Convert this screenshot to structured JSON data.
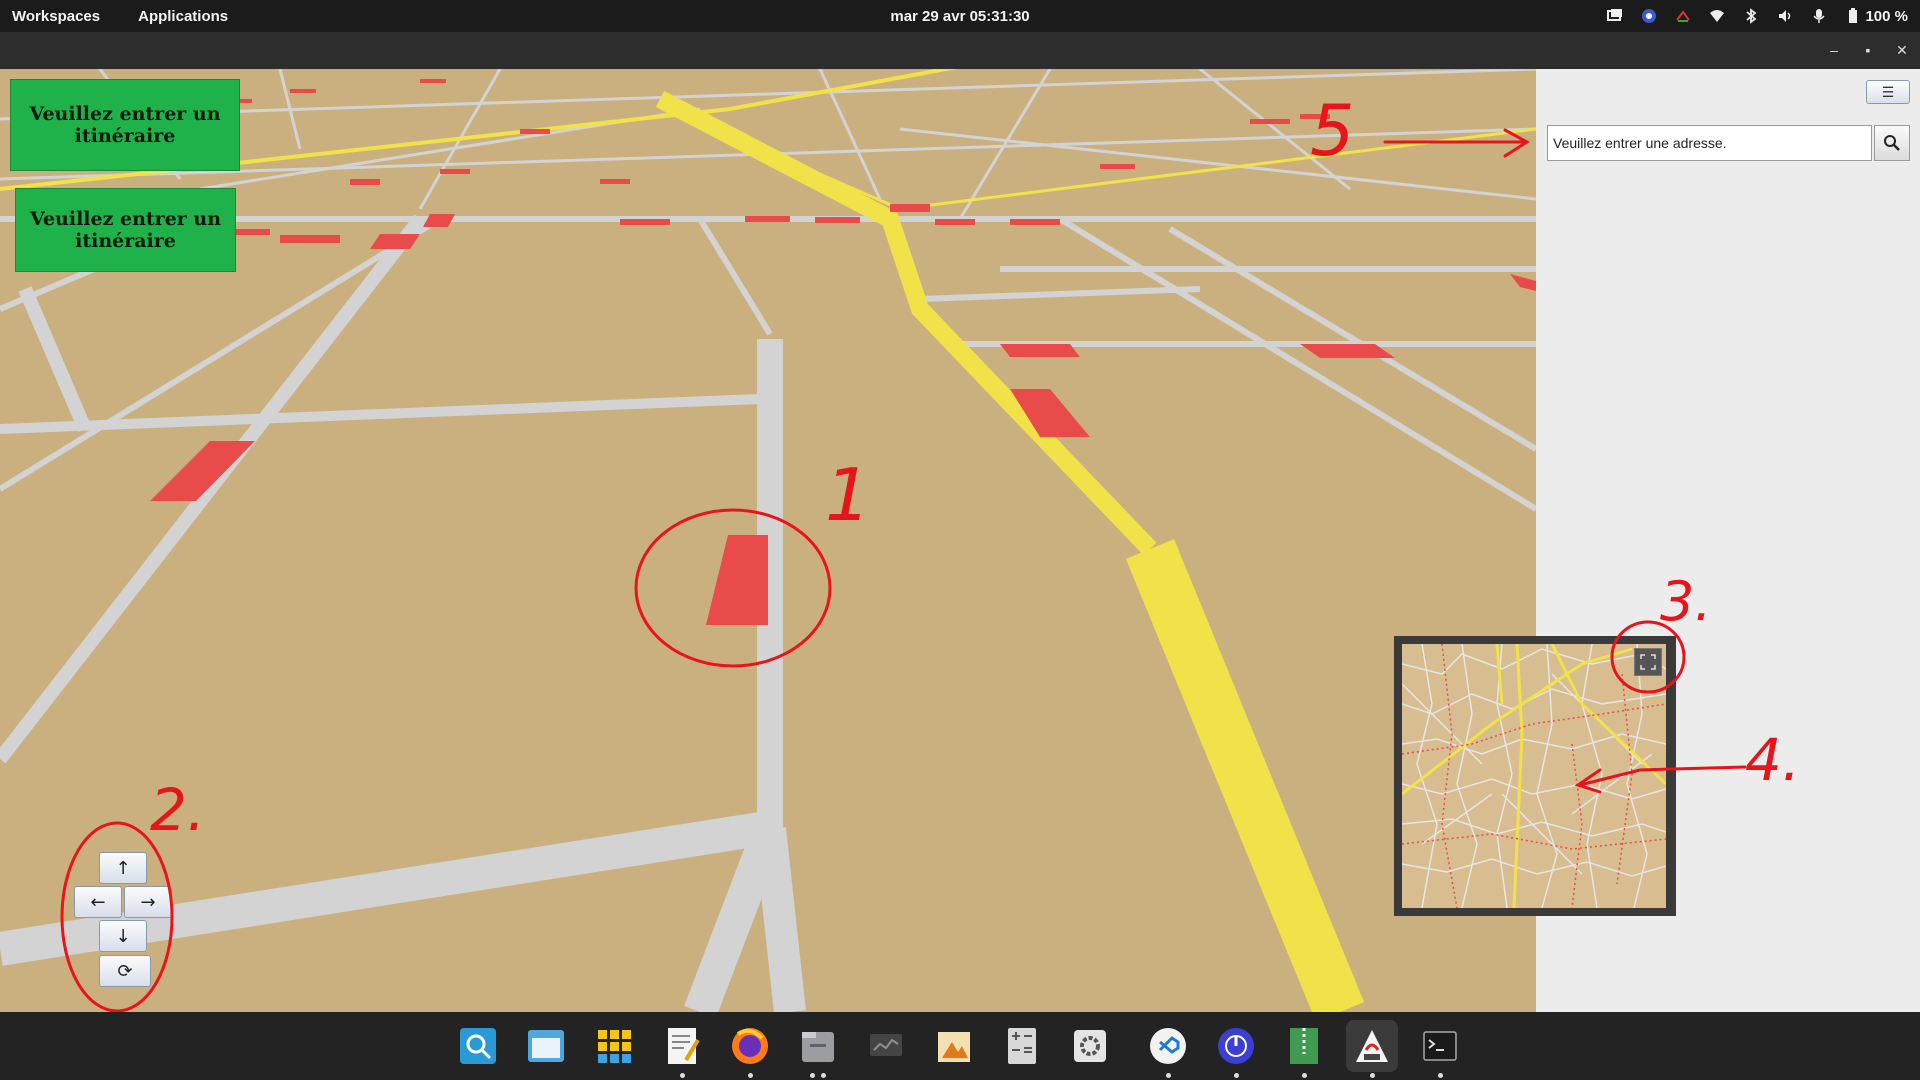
{
  "topbar": {
    "workspaces": "Workspaces",
    "applications": "Applications",
    "clock": "mar 29 avr  05:31:30",
    "battery": "100 %",
    "tray_icons": [
      "screen-share-icon",
      "vpn-icon",
      "network-monitor-icon",
      "wifi-icon",
      "bluetooth-icon",
      "volume-icon",
      "microphone-icon",
      "battery-icon"
    ]
  },
  "window": {
    "controls": [
      "minimize-icon",
      "maximize-icon",
      "close-icon"
    ]
  },
  "map": {
    "route_button_1": "Veuillez entrer un itinéraire",
    "route_button_2": "Veuillez entrer un itinéraire",
    "nav": {
      "up": "↑",
      "left": "←",
      "right": "→",
      "down": "↓",
      "rotate": "⟳"
    },
    "colors": {
      "ground": "#cbb07f",
      "road": "#d3d3d3",
      "main_road": "#f2e24a",
      "building": "#e94b4b",
      "button_green": "#1fb14a"
    }
  },
  "sidebar": {
    "menu_label": "☰",
    "address_placeholder": "Veuillez entrer une adresse.",
    "search_icon": "search-icon"
  },
  "annotations": {
    "n1": "1",
    "n2": "2.",
    "n3": "3.",
    "n4": "4.",
    "n5": "5",
    "color": "#e8141c"
  },
  "dock": {
    "apps": [
      "search-app-icon",
      "file-manager-icon",
      "app-grid-icon",
      "text-editor-icon",
      "firefox-icon",
      "files-icon",
      "system-monitor-icon",
      "image-viewer-icon",
      "calculator-icon",
      "settings-icon",
      "vscode-icon",
      "power-tool-icon",
      "archive-icon",
      "java-app-icon",
      "terminal-icon"
    ]
  }
}
